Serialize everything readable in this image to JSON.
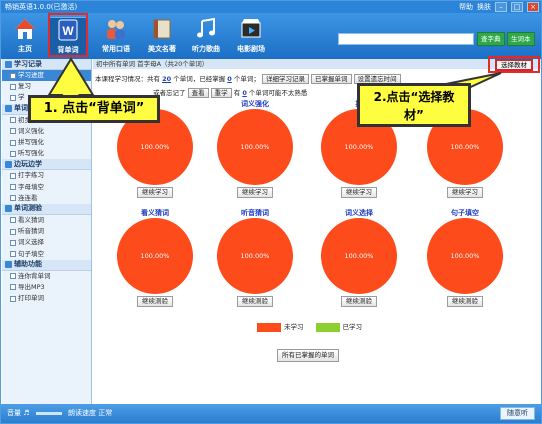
{
  "window": {
    "title": "畅销英语1.0.0(已激活)",
    "help_label": "帮助",
    "skin_label": "换肤",
    "min_label": "–",
    "max_label": "□",
    "close_label": "×"
  },
  "toolbar": {
    "items": [
      {
        "label": "主页",
        "icon": "home-icon"
      },
      {
        "label": "背单词",
        "icon": "word-book-icon"
      },
      {
        "label": "常用口语",
        "icon": "people-icon"
      },
      {
        "label": "美文名著",
        "icon": "book-icon"
      },
      {
        "label": "听力歌曲",
        "icon": "music-note-icon"
      },
      {
        "label": "电影剧场",
        "icon": "film-icon"
      }
    ],
    "search_placeholder": "",
    "search_btn1": "查字典",
    "search_btn2": "生词本"
  },
  "sidebar": {
    "sections": [
      {
        "title": "学习记录",
        "items": [
          "学习进度",
          "复习",
          "学"
        ]
      },
      {
        "title": "单词记忆",
        "items": [
          "初步记忆",
          "词义强化",
          "拼写强化",
          "听写强化"
        ]
      },
      {
        "title": "边玩边学",
        "items": [
          "打字练习",
          "字母填空",
          "连连看"
        ]
      },
      {
        "title": "单词测验",
        "items": [
          "看义猜词",
          "听音猜词",
          "词义选择",
          "句子填空"
        ]
      },
      {
        "title": "辅助功能",
        "items": [
          "连你背单词",
          "导出MP3",
          "打印单词"
        ]
      }
    ]
  },
  "main": {
    "header": "初中所有单词 首字母A（共20个单词）",
    "choose_label": "选择教材",
    "info": {
      "p1": "本课程学习情况：共有",
      "total": "20",
      "p2": "个单词，已经掌握",
      "mastered": "0",
      "p3": "个单词；",
      "btn1": "详细学习记录",
      "btn2": "已掌握单词",
      "btn3": "设置遗忘时间",
      "p4": "或者忘记了",
      "btn4": "查看",
      "btn5": "重学",
      "p5": "有",
      "forget": "0",
      "p6": "个单词可能不太熟悉"
    },
    "row1": [
      {
        "title": "",
        "pct": "100.00%",
        "btn": "继续学习"
      },
      {
        "title": "词义强化",
        "pct": "100.00%",
        "btn": "继续学习"
      },
      {
        "title": "拼",
        "pct": "100.00%",
        "btn": "继续学习"
      },
      {
        "title": "",
        "pct": "100.00%",
        "btn": "继续学习"
      }
    ],
    "row2": [
      {
        "title": "看义猜词",
        "pct": "100.00%",
        "btn": "继续测验"
      },
      {
        "title": "听音猜词",
        "pct": "100.00%",
        "btn": "继续测验"
      },
      {
        "title": "词义选择",
        "pct": "100.00%",
        "btn": "继续测验"
      },
      {
        "title": "句子填空",
        "pct": "100.00%",
        "btn": "继续测验"
      }
    ],
    "legend": [
      {
        "label": "未学习",
        "color": "#fd4b1b"
      },
      {
        "label": "已学习",
        "color": "#8ccf2e"
      }
    ],
    "all_mastered_btn": "所有已掌握的单词"
  },
  "status": {
    "volume_label": "音量",
    "speed_label": "朗读速度",
    "speed_value": "正常",
    "random_btn": "随意听"
  },
  "annotations": {
    "step1": "1. 点击“背单词”",
    "step2": "2.点击“选择教材”"
  }
}
